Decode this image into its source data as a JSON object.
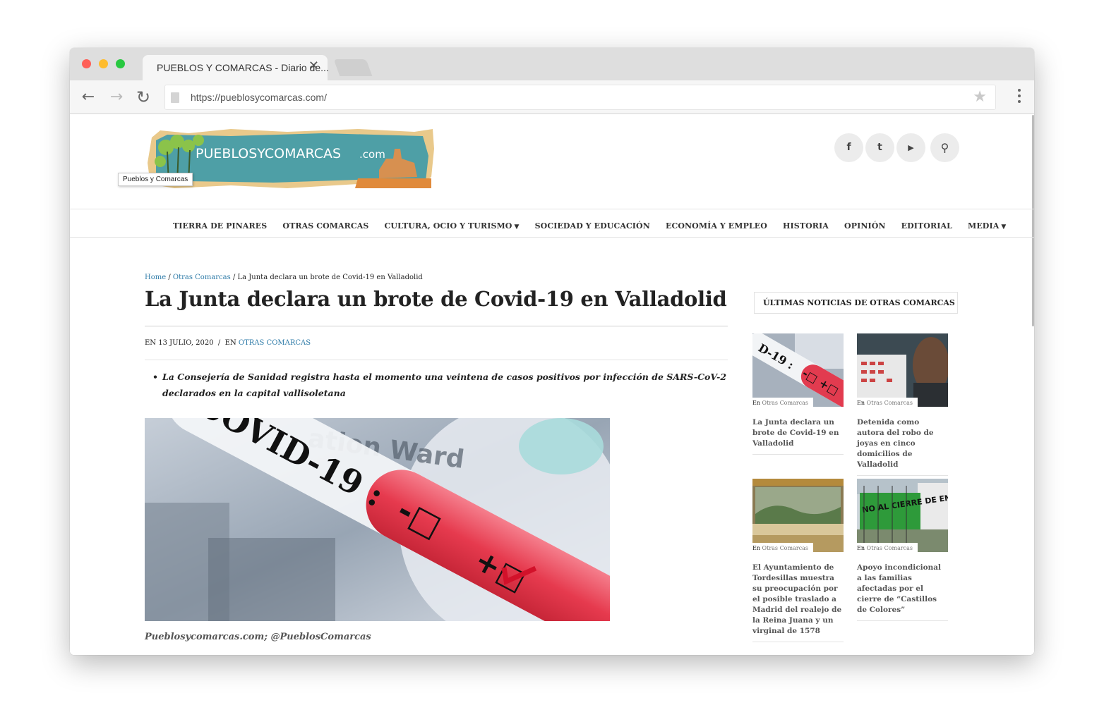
{
  "browser": {
    "tab_title": "PUEBLOS Y COMARCAS - Diario de...",
    "tab_close": "✕",
    "url": "https://pueblosycomarcas.com/",
    "back_icon": "←",
    "forward_icon": "→",
    "reload_icon": "↻",
    "star_icon": "★"
  },
  "site": {
    "logo_text": "PUEBLOSYCOMARCAS",
    "logo_suffix": ".com",
    "logo_tooltip": "Pueblos y Comarcas",
    "social": {
      "facebook": "f",
      "twitter": "t",
      "youtube": "▶",
      "search": "⚲"
    },
    "nav": [
      "TIERRA DE PINARES",
      "OTRAS COMARCAS",
      "CULTURA, OCIO Y TURISMO",
      "SOCIEDAD Y EDUCACIÓN",
      "ECONOMÍA Y EMPLEO",
      "HISTORIA",
      "OPINIÓN",
      "EDITORIAL",
      "MEDIA"
    ]
  },
  "article": {
    "breadcrumb": {
      "home": "Home",
      "sep1": " / ",
      "category": "Otras Comarcas",
      "sep2": " / ",
      "current": "La Junta declara un brote de Covid-19 en Valladolid"
    },
    "title": "La Junta declara un brote de Covid-19 en Valladolid",
    "meta_date": "EN 13 JULIO, 2020",
    "meta_sep": "  /  EN ",
    "meta_category": "OTRAS COMARCAS",
    "lead": "La Consejería de Sanidad registra hasta el momento una veintena de casos positivos por infección de SARS-CoV-2 declarados en la capital vallisoletana",
    "image_text": "COVID-19 :",
    "image_bg_text": "ation Ward",
    "caption": "Pueblosycomarcas.com; @PueblosComarcas"
  },
  "sidebar": {
    "heading": "ÚLTIMAS NOTICIAS DE OTRAS COMARCAS",
    "cat_prefix": "En",
    "cards": [
      {
        "category": "Otras Comarcas",
        "title": "La Junta declara un brote de Covid-19 en Valladolid"
      },
      {
        "category": "Otras Comarcas",
        "title": "Detenida como autora del robo de joyas en cinco domicilios de Valladolid"
      },
      {
        "category": "Otras Comarcas",
        "title": "El Ayuntamiento de Tordesillas muestra su preocupación por el posible traslado a Madrid del realejo de la Reina Juana y un virginal de 1578"
      },
      {
        "category": "Otras Comarcas",
        "title": "Apoyo incondicional a las familias afectadas por el cierre de “Castillos de Colores”"
      }
    ],
    "banner_text": "NO AL CIERRE DE EN CASTILL"
  }
}
